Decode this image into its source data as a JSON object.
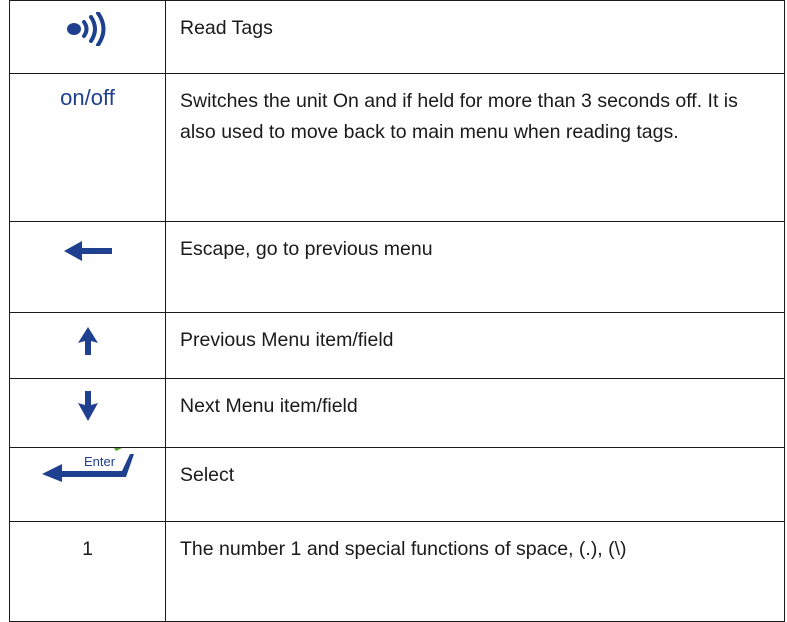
{
  "colors": {
    "icon_blue": "#1f3f8f",
    "enter_green": "#5a9e2f",
    "border": "#1a1a1a"
  },
  "rows": [
    {
      "key_icon": "wireless-read-icon",
      "description": "Read Tags"
    },
    {
      "key_text": "on/off",
      "description": "Switches the unit On and if held for more than 3 seconds off.  It is also used to move back to main menu when reading tags."
    },
    {
      "key_icon": "left-arrow-icon",
      "description": "Escape, go to previous menu"
    },
    {
      "key_icon": "up-arrow-icon",
      "description": "Previous Menu item/field"
    },
    {
      "key_icon": "down-arrow-icon",
      "description": "Next Menu item/field"
    },
    {
      "key_icon": "enter-key-icon",
      "key_text": "Enter",
      "description": "Select"
    },
    {
      "key_text": "1",
      "description": "The number 1 and special functions of space, (.), (\\)"
    }
  ]
}
